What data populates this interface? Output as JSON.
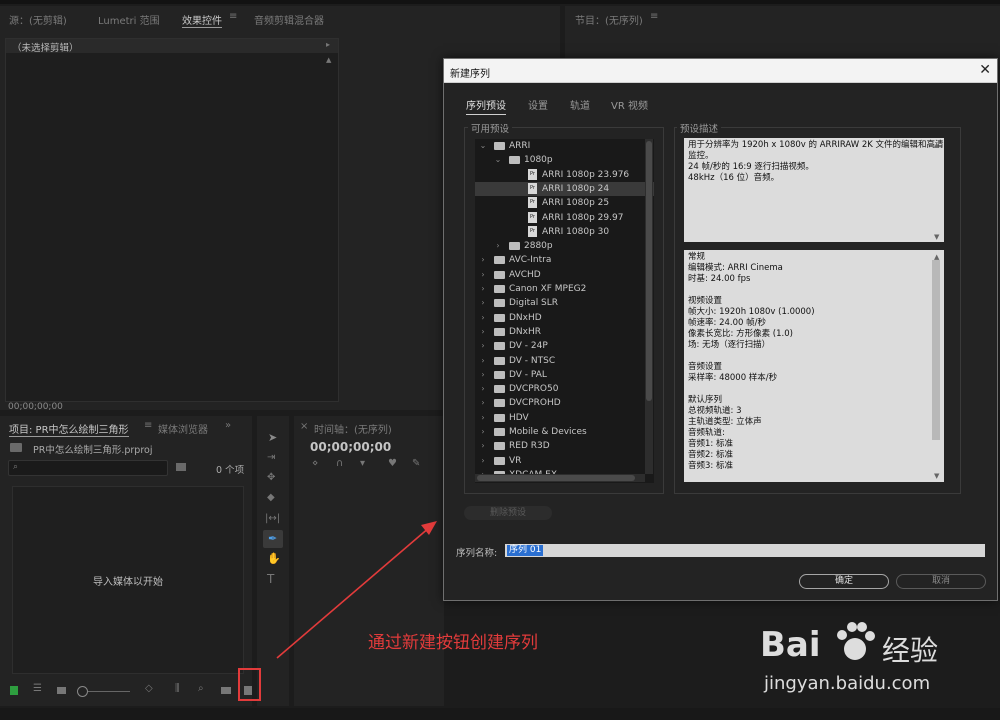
{
  "source_panel": {
    "tabs": [
      "源：(无剪辑)",
      "Lumetri 范围",
      "效果控件",
      "音频剪辑混合器"
    ],
    "active_tab": "效果控件",
    "clip_label": "（未选择剪辑）",
    "timecode": "00;00;00;00"
  },
  "program_panel": {
    "tab": "节目：(无序列)"
  },
  "project_panel": {
    "tabs": [
      "项目: PR中怎么绘制三角形",
      "媒体浏览器"
    ],
    "project_file": "PR中怎么绘制三角形.prproj",
    "item_count": "0 个项",
    "empty_message": "导入媒体以开始"
  },
  "timeline_panel": {
    "tab": "时间轴：(无序列)",
    "timecode": "00;00;00;00"
  },
  "dialog": {
    "title": "新建序列",
    "tabs": [
      "序列预设",
      "设置",
      "轨道",
      "VR 视频"
    ],
    "active_tab": "序列预设",
    "available_presets_label": "可用预设",
    "preset_description_label": "预设描述",
    "tree": [
      {
        "label": "ARRI",
        "level": 0,
        "type": "folder",
        "expanded": true
      },
      {
        "label": "1080p",
        "level": 1,
        "type": "folder",
        "expanded": true
      },
      {
        "label": "ARRI 1080p 23.976",
        "level": 2,
        "type": "preset"
      },
      {
        "label": "ARRI 1080p 24",
        "level": 2,
        "type": "preset",
        "selected": true
      },
      {
        "label": "ARRI 1080p 25",
        "level": 2,
        "type": "preset"
      },
      {
        "label": "ARRI 1080p 29.97",
        "level": 2,
        "type": "preset"
      },
      {
        "label": "ARRI 1080p 30",
        "level": 2,
        "type": "preset"
      },
      {
        "label": "2880p",
        "level": 1,
        "type": "folder",
        "expanded": false
      },
      {
        "label": "AVC-Intra",
        "level": 0,
        "type": "folder",
        "expanded": false
      },
      {
        "label": "AVCHD",
        "level": 0,
        "type": "folder",
        "expanded": false
      },
      {
        "label": "Canon XF MPEG2",
        "level": 0,
        "type": "folder",
        "expanded": false
      },
      {
        "label": "Digital SLR",
        "level": 0,
        "type": "folder",
        "expanded": false
      },
      {
        "label": "DNxHD",
        "level": 0,
        "type": "folder",
        "expanded": false
      },
      {
        "label": "DNxHR",
        "level": 0,
        "type": "folder",
        "expanded": false
      },
      {
        "label": "DV - 24P",
        "level": 0,
        "type": "folder",
        "expanded": false
      },
      {
        "label": "DV - NTSC",
        "level": 0,
        "type": "folder",
        "expanded": false
      },
      {
        "label": "DV - PAL",
        "level": 0,
        "type": "folder",
        "expanded": false
      },
      {
        "label": "DVCPRO50",
        "level": 0,
        "type": "folder",
        "expanded": false
      },
      {
        "label": "DVCPROHD",
        "level": 0,
        "type": "folder",
        "expanded": false
      },
      {
        "label": "HDV",
        "level": 0,
        "type": "folder",
        "expanded": false
      },
      {
        "label": "Mobile & Devices",
        "level": 0,
        "type": "folder",
        "expanded": false
      },
      {
        "label": "RED R3D",
        "level": 0,
        "type": "folder",
        "expanded": false
      },
      {
        "label": "VR",
        "level": 0,
        "type": "folder",
        "expanded": false
      },
      {
        "label": "XDCAM EX",
        "level": 0,
        "type": "folder",
        "expanded": false
      }
    ],
    "description_lines": [
      "用于分辨率为 1920h x 1080v 的 ARRIRAW 2K 文件的编辑和高清",
      "监控。",
      "24 帧/秒的 16:9 逐行扫描视频。",
      "48kHz（16 位）音频。"
    ],
    "details_lines": [
      "常规",
      " 编辑模式: ARRI Cinema",
      " 时基: 24.00 fps",
      "",
      "视频设置",
      " 帧大小: 1920h 1080v (1.0000)",
      " 帧速率: 24.00 帧/秒",
      " 像素长宽比: 方形像素 (1.0)",
      " 场: 无场（逐行扫描）",
      "",
      "音频设置",
      " 采样率: 48000 样本/秒",
      "",
      "默认序列",
      " 总视频轨道: 3",
      " 主轨道类型: 立体声",
      " 音频轨道:",
      " 音频1: 标准",
      " 音频2: 标准",
      " 音频3: 标准"
    ],
    "delete_preset_label": "删除预设",
    "sequence_name_label": "序列名称:",
    "sequence_name_value": "序列 01",
    "ok_label": "确定",
    "cancel_label": "取消"
  },
  "annotation": {
    "text": "通过新建按钮创建序列",
    "color": "#e23b3b"
  },
  "watermark": {
    "brand": "Bai",
    "brand_suffix": "经验",
    "url": "jingyan.baidu.com"
  }
}
